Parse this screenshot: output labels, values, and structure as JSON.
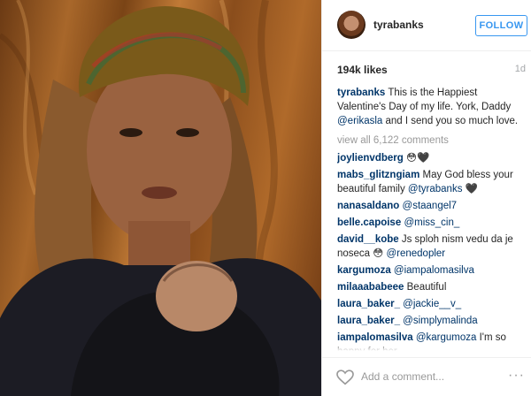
{
  "post": {
    "username": "tyrabanks",
    "follow_label": "FOLLOW",
    "likes": "194k likes",
    "time": "1d"
  },
  "caption": {
    "user": "tyrabanks",
    "text_before": " This is the Happiest Valentine's Day of my life. York, Daddy ",
    "mention": "@erikasla",
    "text_after": " and I send you so much love."
  },
  "view_all": "view all 6,122 comments",
  "comments": [
    {
      "user": "joylienvdberg",
      "text": " 😳🖤",
      "mention": ""
    },
    {
      "user": "mabs_glitzngiam",
      "text": " May God bless your beautiful family ",
      "mention": "@tyrabanks",
      "tail": " 🖤"
    },
    {
      "user": "nanasaldano",
      "text": " ",
      "mention": "@staangel7"
    },
    {
      "user": "belle.capoise",
      "text": " ",
      "mention": "@miss_cin_"
    },
    {
      "user": "david__kobe",
      "text": " Js sploh nism vedu da je noseca 😳 ",
      "mention": "@renedopler"
    },
    {
      "user": "kargumoza",
      "text": " ",
      "mention": "@iampalomasilva"
    },
    {
      "user": "milaaababeee",
      "text": " Beautiful",
      "mention": ""
    },
    {
      "user": "laura_baker_",
      "text": " ",
      "mention": "@jackie__v_"
    },
    {
      "user": "laura_baker_",
      "text": " ",
      "mention": "@simplymalinda"
    },
    {
      "user": "iampalomasilva",
      "text": " ",
      "mention": "@kargumoza",
      "tail": " I'm so happy for her"
    }
  ],
  "footer": {
    "add_comment_placeholder": "Add a comment...",
    "more_label": "···"
  }
}
